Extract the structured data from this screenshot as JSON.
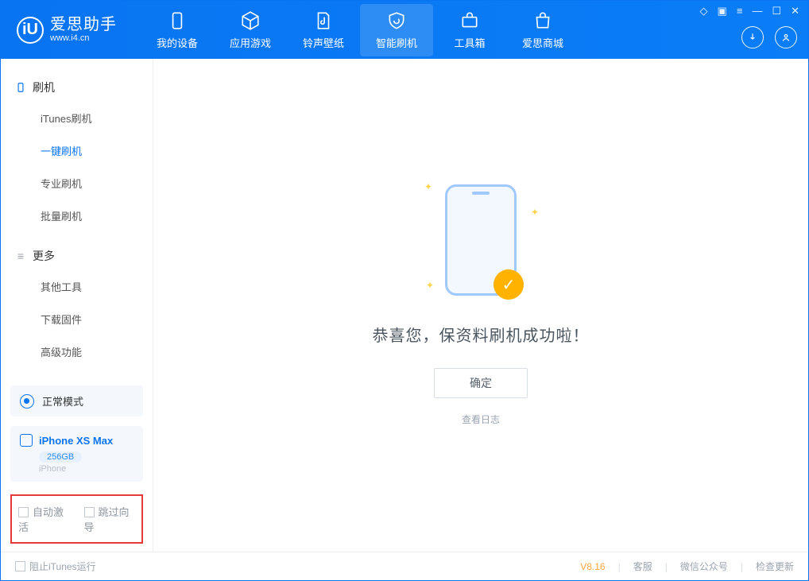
{
  "brand": {
    "name": "爱思助手",
    "url": "www.i4.cn"
  },
  "nav": {
    "items": [
      {
        "label": "我的设备"
      },
      {
        "label": "应用游戏"
      },
      {
        "label": "铃声壁纸"
      },
      {
        "label": "智能刷机"
      },
      {
        "label": "工具箱"
      },
      {
        "label": "爱思商城"
      }
    ]
  },
  "sidebar": {
    "group1_title": "刷机",
    "group1_items": [
      {
        "label": "iTunes刷机"
      },
      {
        "label": "一键刷机"
      },
      {
        "label": "专业刷机"
      },
      {
        "label": "批量刷机"
      }
    ],
    "group2_title": "更多",
    "group2_items": [
      {
        "label": "其他工具"
      },
      {
        "label": "下载固件"
      },
      {
        "label": "高级功能"
      }
    ],
    "mode_label": "正常模式",
    "device": {
      "name": "iPhone XS Max",
      "capacity": "256GB",
      "type": "iPhone"
    },
    "options": {
      "auto_activate": "自动激活",
      "skip_guide": "跳过向导"
    }
  },
  "main": {
    "success_msg": "恭喜您，保资料刷机成功啦！",
    "confirm_label": "确定",
    "log_link": "查看日志"
  },
  "footer": {
    "block_itunes": "阻止iTunes运行",
    "version": "V8.16",
    "support": "客服",
    "wechat": "微信公众号",
    "update": "检查更新"
  }
}
